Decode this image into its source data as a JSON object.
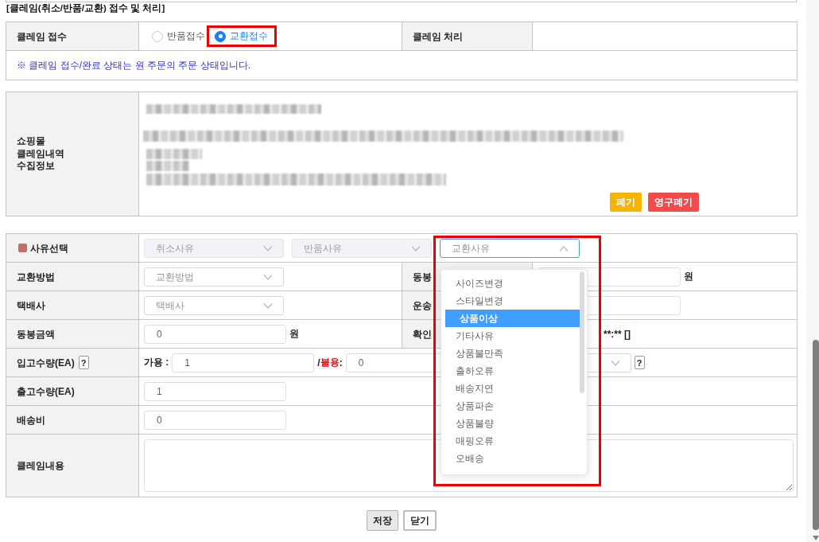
{
  "section_title": "[클레임(취소/반품/교환) 접수 및 처리]",
  "claim_status": {
    "receipt_label": "클레임 접수",
    "receipt_options": [
      {
        "label": "반품접수",
        "selected": false,
        "highlighted": false
      },
      {
        "label": "교환접수",
        "selected": true,
        "highlighted": true
      }
    ],
    "processing_label": "클레임 처리",
    "notice": "※ 클레임 접수/완료 상태는 원 주문의 주문 상태입니다."
  },
  "collected_claim_info": {
    "label": "쇼핑몰\n클레임내역\n수집정보",
    "buttons": [
      {
        "label": "폐기",
        "kind": "discard"
      },
      {
        "label": "영구폐기",
        "kind": "purge"
      }
    ]
  },
  "claim_form": {
    "rows": [
      {
        "label": "사유선택",
        "marked": true,
        "fields": [
          {
            "kind": "select",
            "placeholder": "취소사유",
            "disabled": true,
            "expanded": false,
            "highlighted": false
          },
          {
            "kind": "select",
            "placeholder": "반품사유",
            "disabled": true,
            "expanded": false,
            "highlighted": false
          },
          {
            "kind": "select",
            "placeholder": "교환사유",
            "disabled": false,
            "expanded": true,
            "highlighted": true,
            "options": [
              {
                "label": "사이즈변경",
                "selected": false
              },
              {
                "label": "스타일변경",
                "selected": false
              },
              {
                "label": "상품이상",
                "selected": true
              },
              {
                "label": "기타사유",
                "selected": false
              },
              {
                "label": "상품불만족",
                "selected": false
              },
              {
                "label": "출하오류",
                "selected": false
              },
              {
                "label": "배송지연",
                "selected": false
              },
              {
                "label": "상품파손",
                "selected": false
              },
              {
                "label": "상품불량",
                "selected": false
              },
              {
                "label": "매핑오류",
                "selected": false
              },
              {
                "label": "오배송",
                "selected": false
              }
            ]
          }
        ]
      },
      {
        "label": "교환방법",
        "marked": false,
        "fields": [
          {
            "kind": "select",
            "placeholder": "교환방법",
            "disabled": false,
            "expanded": false,
            "highlighted": false
          }
        ],
        "side": {
          "label": "동봉",
          "fields": [
            {
              "kind": "input"
            },
            {
              "kind": "unit",
              "text": "원"
            }
          ]
        }
      },
      {
        "label": "택배사",
        "marked": false,
        "fields": [
          {
            "kind": "select",
            "placeholder": "택배사",
            "disabled": false,
            "expanded": false,
            "highlighted": false
          }
        ],
        "side": {
          "label": "운송",
          "fields": [
            {
              "kind": "input"
            }
          ]
        }
      },
      {
        "label": "동봉금액",
        "marked": false,
        "fields": [
          {
            "kind": "input",
            "value": "0"
          },
          {
            "kind": "unit",
            "text": "원"
          }
        ],
        "side": {
          "label": "확인",
          "fields": [
            {
              "kind": "clipped",
              "text": "**:** []"
            }
          ]
        }
      },
      {
        "label": "입고수량(EA)",
        "marked": false,
        "help": "?",
        "fields": [
          {
            "kind": "text",
            "text": "가용 :",
            "emphasis": false
          },
          {
            "kind": "input",
            "value": "1"
          },
          {
            "kind": "text",
            "text": "/",
            "emphasis": false
          },
          {
            "kind": "text",
            "text": "불용",
            "emphasis": true
          },
          {
            "kind": "text",
            "text": ":",
            "emphasis": false
          },
          {
            "kind": "input",
            "value": "0"
          },
          {
            "kind": "select",
            "expanded": false
          },
          {
            "kind": "help",
            "label": "?"
          }
        ]
      },
      {
        "label": "출고수량(EA)",
        "marked": false,
        "fields": [
          {
            "kind": "input",
            "value": "1"
          }
        ]
      },
      {
        "label": "배송비",
        "marked": false,
        "fields": [
          {
            "kind": "input",
            "value": "0"
          }
        ]
      },
      {
        "label": "클레임내용",
        "marked": false,
        "fields": [
          {
            "kind": "textarea"
          }
        ]
      }
    ]
  },
  "buttons": [
    {
      "label": "저장",
      "kind": "save"
    },
    {
      "label": "닫기",
      "kind": "close"
    }
  ]
}
